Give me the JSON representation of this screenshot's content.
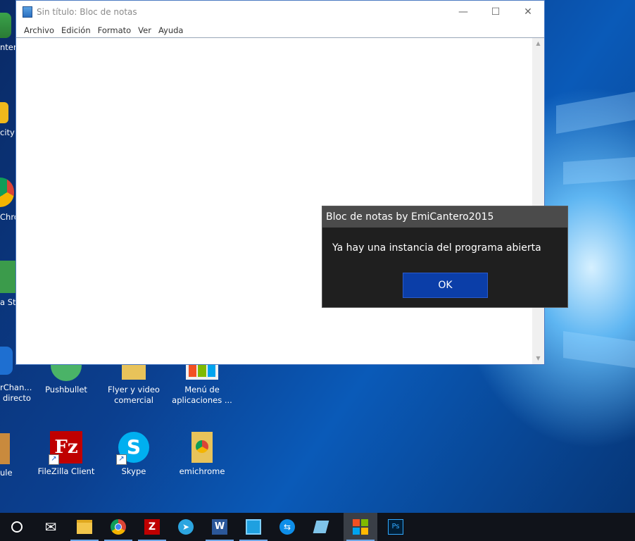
{
  "notepad": {
    "title": "Sin título: Bloc de notas",
    "menu": [
      "Archivo",
      "Edición",
      "Formato",
      "Ver",
      "Ayuda"
    ],
    "controls": {
      "minimize": "—",
      "maximize": "☐",
      "close": "✕"
    }
  },
  "dialog": {
    "title": "Bloc de notas by EmiCantero2015",
    "message": "Ya hay una instancia del programa abierta",
    "ok_label": "OK"
  },
  "desktop": {
    "partial_labels": [
      "nter",
      "city",
      "Chro",
      "a Stu",
      "rChan...",
      "directo",
      "ule"
    ],
    "icons": [
      {
        "label": "Pushbullet",
        "icon": "pushbullet-icon",
        "color": "#4ab367"
      },
      {
        "label": "Flyer y video comercial",
        "icon": "folder-icon",
        "color": "#e8c35a"
      },
      {
        "label": "Menú de aplicaciones ...",
        "icon": "apps-menu-icon",
        "color": "#f0f0f0"
      },
      {
        "label": "FileZilla Client",
        "icon": "filezilla-icon",
        "color": "#bf0000"
      },
      {
        "label": "Skype",
        "icon": "skype-icon",
        "color": "#00aff0"
      },
      {
        "label": "emichrome",
        "icon": "folder-icon",
        "color": "#e8c35a"
      }
    ]
  },
  "taskbar": {
    "items": [
      {
        "name": "cortana-icon",
        "glyph": "○",
        "color": "#ffffff"
      },
      {
        "name": "mail-icon",
        "glyph": "✉",
        "color": "#ffffff"
      },
      {
        "name": "file-explorer-icon",
        "glyph": "",
        "color": "#f2c54b"
      },
      {
        "name": "chrome-icon",
        "glyph": "",
        "color": "#e0483e"
      },
      {
        "name": "filezilla-icon",
        "glyph": "Z",
        "color": "#bf0000"
      },
      {
        "name": "telegram-icon",
        "glyph": "➤",
        "color": "#2ca5e0"
      },
      {
        "name": "word-icon",
        "glyph": "W",
        "color": "#2b579a"
      },
      {
        "name": "app-icon",
        "glyph": "◪",
        "color": "#1fa0e0"
      },
      {
        "name": "teamviewer-icon",
        "glyph": "⇆",
        "color": "#0e8ee9"
      },
      {
        "name": "app-icon-2",
        "glyph": "◆",
        "color": "#7fc4ea"
      },
      {
        "name": "notepad-app-icon",
        "glyph": "",
        "color": "#f25022",
        "active": true
      },
      {
        "name": "photoshop-icon",
        "glyph": "Ps",
        "color": "#31a8ff"
      }
    ]
  }
}
